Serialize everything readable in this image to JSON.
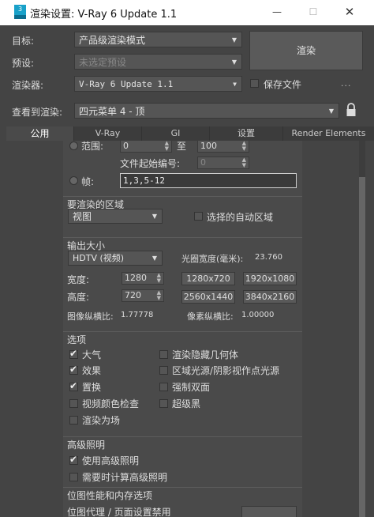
{
  "window": {
    "app_icon_text": "3",
    "title": "渲染设置: V-Ray 6 Update 1.1",
    "minimize_glyph": "—",
    "maximize_glyph": "☐",
    "close_glyph": "✕"
  },
  "top": {
    "target_label": "目标:",
    "target_value": "产品级渲染模式",
    "preset_label": "预设:",
    "preset_value": "未选定预设",
    "renderer_label": "渲染器:",
    "renderer_value": "V-Ray 6 Update 1.1",
    "save_file_label": "保存文件",
    "more_label": "...",
    "render_button": "渲染",
    "view_label": "查看到渲染:",
    "view_value": "四元菜单 4 - 顶"
  },
  "tabs": [
    {
      "label": "公用",
      "active": true
    },
    {
      "label": "V-Ray",
      "active": false
    },
    {
      "label": "GI",
      "active": false
    },
    {
      "label": "设置",
      "active": false
    },
    {
      "label": "Render Elements",
      "active": false
    }
  ],
  "time_output": {
    "range_label": "范围:",
    "range_start": "0",
    "range_to": "至",
    "range_end": "100",
    "file_start_label": "文件起始编号:",
    "file_start_value": "0",
    "frames_label": "帧:",
    "frames_value": "1,3,5-12"
  },
  "area": {
    "title": "要渲染的区域",
    "mode_value": "视图",
    "auto_region_label": "选择的自动区域"
  },
  "output_size": {
    "title": "输出大小",
    "format_value": "HDTV (视频)",
    "aperture_label": "光圈宽度(毫米):",
    "aperture_value": "23.760",
    "width_label": "宽度:",
    "width_value": "1280",
    "height_label": "高度:",
    "height_value": "720",
    "presets": [
      "1280x720",
      "1920x1080",
      "2560x1440",
      "3840x2160"
    ],
    "image_aspect_label": "图像纵横比:",
    "image_aspect_value": "1.77778",
    "pixel_aspect_label": "像素纵横比:",
    "pixel_aspect_value": "1.00000"
  },
  "options": {
    "title": "选项",
    "left": [
      {
        "label": "大气",
        "checked": true
      },
      {
        "label": "效果",
        "checked": true
      },
      {
        "label": "置换",
        "checked": true
      },
      {
        "label": "视频颜色检查",
        "checked": false
      },
      {
        "label": "渲染为场",
        "checked": false
      }
    ],
    "right": [
      {
        "label": "渲染隐藏几何体",
        "checked": false
      },
      {
        "label": "区域光源/阴影视作点光源",
        "checked": false
      },
      {
        "label": "强制双面",
        "checked": false
      },
      {
        "label": "超级黑",
        "checked": false
      }
    ]
  },
  "advanced_lighting": {
    "title": "高级照明",
    "use_label": "使用高级照明",
    "use_checked": true,
    "compute_label": "需要时计算高级照明",
    "compute_checked": false
  },
  "bitmap": {
    "title": "位图性能和内存选项",
    "partial_text": "位图代理 / 页面设置禁用"
  }
}
